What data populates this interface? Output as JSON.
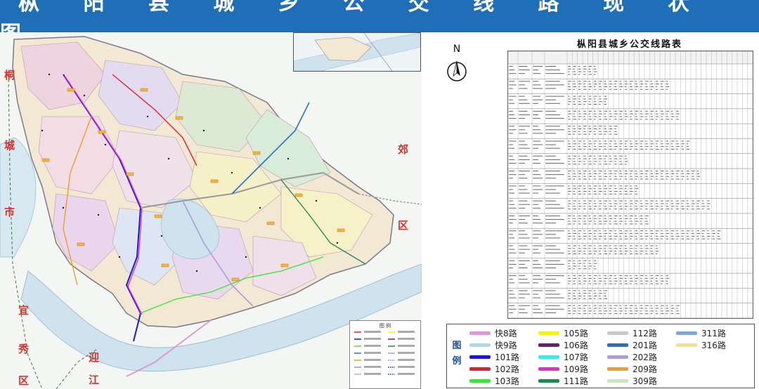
{
  "title": "枞 阳 县 城 乡 公 交 线 路 现 状 图",
  "compass": {
    "letter": "N"
  },
  "table": {
    "title": "枞阳县城乡公交线路表",
    "row_count": 17,
    "col_count": 40
  },
  "map": {
    "side_labels": [
      "桐",
      "城",
      "市",
      "宜",
      "秀",
      "区",
      "郊",
      "区",
      "迎",
      "江"
    ],
    "legend_title": "图 例"
  },
  "legend": {
    "label_chars": [
      "图",
      "例"
    ],
    "items": [
      {
        "name": "快8路",
        "color": "#d99bd2"
      },
      {
        "name": "快9路",
        "color": "#a9dbe9"
      },
      {
        "name": "101路",
        "color": "#1a1ac8"
      },
      {
        "name": "102路",
        "color": "#e41e2b"
      },
      {
        "name": "103路",
        "color": "#3be33b"
      },
      {
        "name": "105路",
        "color": "#f5ef1e"
      },
      {
        "name": "106路",
        "color": "#6b1f6b"
      },
      {
        "name": "107路",
        "color": "#3fe6f0"
      },
      {
        "name": "109路",
        "color": "#e62ad6"
      },
      {
        "name": "111路",
        "color": "#1f8a4f"
      },
      {
        "name": "112路",
        "color": "#c8c8c8"
      },
      {
        "name": "201路",
        "color": "#2a6fc0"
      },
      {
        "name": "202路",
        "color": "#a9a0da"
      },
      {
        "name": "209路",
        "color": "#f29a2e"
      },
      {
        "name": "309路",
        "color": "#c9e5c2"
      },
      {
        "name": "311路",
        "color": "#7fa8d8"
      },
      {
        "name": "316路",
        "color": "#efe28a"
      }
    ]
  }
}
